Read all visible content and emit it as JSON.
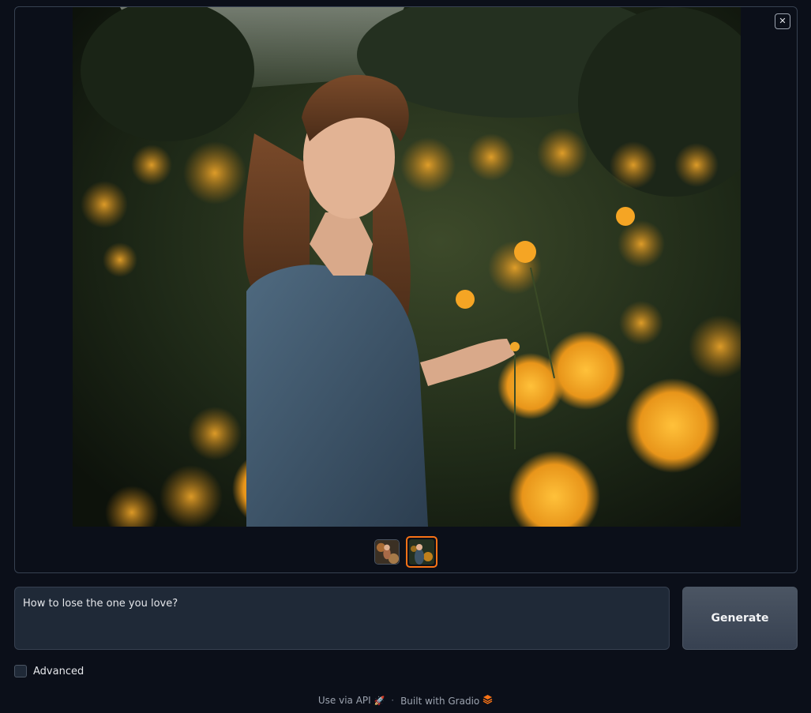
{
  "gallery": {
    "close_label": "✕",
    "thumbnails": [
      {
        "name": "thumbnail-1",
        "selected": false
      },
      {
        "name": "thumbnail-2",
        "selected": true
      }
    ]
  },
  "prompt": {
    "value": "How to lose the one you love?"
  },
  "generate": {
    "label": "Generate"
  },
  "advanced": {
    "label": "Advanced",
    "checked": false
  },
  "footer": {
    "api_label": "Use via API",
    "separator": "·",
    "built_label": "Built with Gradio"
  },
  "colors": {
    "background": "#0b0f19",
    "accent": "#f97316",
    "panel": "#1f2937",
    "border": "#374151"
  },
  "icons": {
    "close": "close-icon",
    "api": "rocket-icon",
    "gradio": "gradio-logo-icon"
  }
}
